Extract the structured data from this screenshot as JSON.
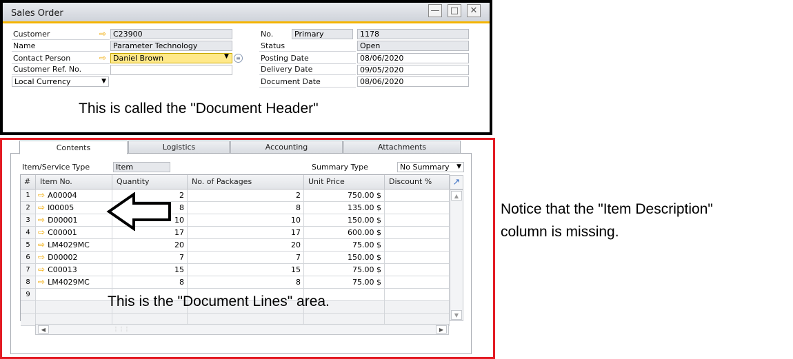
{
  "window": {
    "title": "Sales Order"
  },
  "header_left": {
    "customer_label": "Customer",
    "customer_value": "C23900",
    "name_label": "Name",
    "name_value": "Parameter Technology",
    "contact_label": "Contact Person",
    "contact_value": "Daniel Brown",
    "ref_label": "Customer Ref. No.",
    "ref_value": "",
    "currency_select": "Local Currency"
  },
  "header_right": {
    "no_label": "No.",
    "series_value": "Primary",
    "no_value": "1178",
    "status_label": "Status",
    "status_value": "Open",
    "posting_label": "Posting Date",
    "posting_value": "08/06/2020",
    "delivery_label": "Delivery Date",
    "delivery_value": "09/05/2020",
    "docdate_label": "Document Date",
    "docdate_value": "08/06/2020"
  },
  "annotations": {
    "header_note": "This is called the \"Document Header\"",
    "lines_note": "This is the \"Document Lines\" area.",
    "side_note_1": "Notice that the \"Item Description\"",
    "side_note_2": "column is missing."
  },
  "tabs": [
    {
      "label": "Contents"
    },
    {
      "label": "Logistics"
    },
    {
      "label": "Accounting"
    },
    {
      "label": "Attachments"
    }
  ],
  "contents": {
    "item_type_label": "Item/Service Type",
    "item_type_value": "Item",
    "summary_label": "Summary Type",
    "summary_value": "No Summary"
  },
  "grid": {
    "columns": [
      "#",
      "Item No.",
      "Quantity",
      "No. of Packages",
      "Unit Price",
      "Discount %"
    ],
    "rows": [
      {
        "n": "1",
        "item": "A00004",
        "qty": "2",
        "pkgs": "2",
        "price": "750.00 $"
      },
      {
        "n": "2",
        "item": "I00005",
        "qty": "8",
        "pkgs": "8",
        "price": "135.00 $"
      },
      {
        "n": "3",
        "item": "D00001",
        "qty": "10",
        "pkgs": "10",
        "price": "150.00 $"
      },
      {
        "n": "4",
        "item": "C00001",
        "qty": "17",
        "pkgs": "17",
        "price": "600.00 $"
      },
      {
        "n": "5",
        "item": "LM4029MC",
        "qty": "20",
        "pkgs": "20",
        "price": "75.00 $"
      },
      {
        "n": "6",
        "item": "D00002",
        "qty": "7",
        "pkgs": "7",
        "price": "150.00 $"
      },
      {
        "n": "7",
        "item": "C00013",
        "qty": "15",
        "pkgs": "15",
        "price": "75.00 $"
      },
      {
        "n": "8",
        "item": "LM4029MC",
        "qty": "8",
        "pkgs": "8",
        "price": "75.00 $"
      },
      {
        "n": "9",
        "item": "",
        "qty": "",
        "pkgs": "",
        "price": ""
      }
    ]
  },
  "colors": {
    "header_border": "#000000",
    "lines_border": "#e31b23",
    "accent": "#f4b400"
  }
}
